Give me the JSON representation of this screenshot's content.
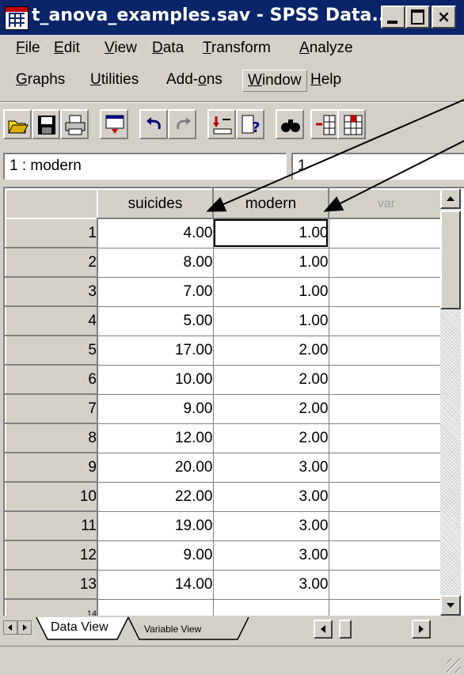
{
  "window": {
    "title": "t_anova_examples.sav - SPSS Data...",
    "close_glyph": "×"
  },
  "menu": {
    "row1": [
      {
        "key": "file",
        "underline": "F",
        "rest": "ile"
      },
      {
        "key": "edit",
        "underline": "E",
        "rest": "dit"
      },
      {
        "key": "view",
        "underline": "V",
        "rest": "iew"
      },
      {
        "key": "data",
        "underline": "D",
        "rest": "ata"
      },
      {
        "key": "transform",
        "underline": "T",
        "rest": "ransform"
      },
      {
        "key": "analyze",
        "underline": "A",
        "rest": "nalyze"
      }
    ],
    "row2": [
      {
        "key": "graphs",
        "underline": "G",
        "rest": "raphs"
      },
      {
        "key": "utilities",
        "underline": "U",
        "rest": "tilities"
      },
      {
        "key": "addons",
        "pre": "Add-",
        "underline": "o",
        "rest": "ns"
      },
      {
        "key": "window",
        "underline": "W",
        "rest": "indow"
      },
      {
        "key": "help",
        "underline": "H",
        "rest": "elp"
      }
    ]
  },
  "toolbar": {
    "icons": [
      "open-icon",
      "save-icon",
      "print-icon",
      "recall-dialog-icon",
      "undo-icon",
      "redo-icon",
      "goto-case-icon",
      "variables-icon",
      "find-icon",
      "insert-case-icon",
      "insert-variable-icon"
    ]
  },
  "editor": {
    "cell_name": "1 : modern",
    "cell_value": "1"
  },
  "grid": {
    "columns": [
      "suicides",
      "modern",
      "var"
    ],
    "rows": [
      {
        "n": "1",
        "suicides": "4.00",
        "modern": "1.00"
      },
      {
        "n": "2",
        "suicides": "8.00",
        "modern": "1.00"
      },
      {
        "n": "3",
        "suicides": "7.00",
        "modern": "1.00"
      },
      {
        "n": "4",
        "suicides": "5.00",
        "modern": "1.00"
      },
      {
        "n": "5",
        "suicides": "17.00",
        "modern": "2.00"
      },
      {
        "n": "6",
        "suicides": "10.00",
        "modern": "2.00"
      },
      {
        "n": "7",
        "suicides": "9.00",
        "modern": "2.00"
      },
      {
        "n": "8",
        "suicides": "12.00",
        "modern": "2.00"
      },
      {
        "n": "9",
        "suicides": "20.00",
        "modern": "3.00"
      },
      {
        "n": "10",
        "suicides": "22.00",
        "modern": "3.00"
      },
      {
        "n": "11",
        "suicides": "19.00",
        "modern": "3.00"
      },
      {
        "n": "12",
        "suicides": "9.00",
        "modern": "3.00"
      },
      {
        "n": "13",
        "suicides": "14.00",
        "modern": "3.00"
      }
    ],
    "partial_row_label": "14"
  },
  "tabs": {
    "data_view": "Data View",
    "variable_view": "Variable View"
  },
  "colors": {
    "titlebar": "#0a246a",
    "chrome": "#d4d0c8"
  }
}
